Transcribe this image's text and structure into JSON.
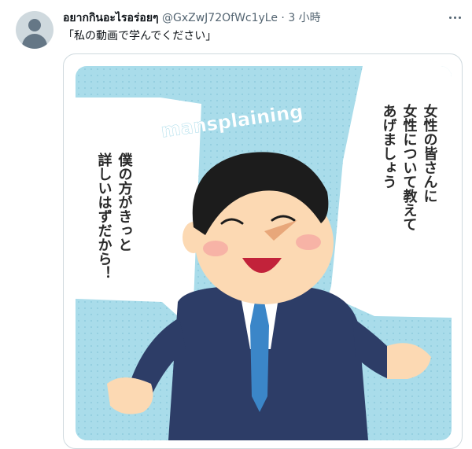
{
  "tweet": {
    "display_name": "อยากกินอะไรอร่อยๆ",
    "handle": "@GxZwJ72OfWc1yLe",
    "separator": "·",
    "time": "3 小時",
    "text": "「私の動画で学んでください」"
  },
  "illustration": {
    "banner": "mansplaining",
    "bubble_right": [
      "女性の皆さんに",
      "女性について教えて",
      "あげましょう"
    ],
    "bubble_left": [
      "僕の方がきっと",
      "詳しいはずだから！"
    ]
  },
  "colors": {
    "background_blue": "#a9dcea",
    "suit": "#2d3d67",
    "tie": "#3b86c8",
    "skin": "#fcd9b3",
    "hair": "#1c1c1c"
  }
}
